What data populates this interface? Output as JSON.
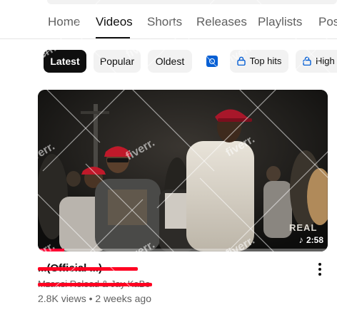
{
  "tabs": [
    {
      "label": "Home"
    },
    {
      "label": "Videos"
    },
    {
      "label": "Shorts"
    },
    {
      "label": "Releases"
    },
    {
      "label": "Playlists"
    },
    {
      "label": "Pos"
    }
  ],
  "active_tab": "Videos",
  "filters": {
    "chips": [
      {
        "label": "Latest"
      },
      {
        "label": "Popular"
      },
      {
        "label": "Oldest"
      }
    ],
    "selected": "Latest",
    "members_only": [
      {
        "label": "Top hits"
      },
      {
        "label": "High"
      }
    ]
  },
  "video": {
    "duration": "2:58",
    "progress": 0.09,
    "thumbnail_overlay_text": "REAL",
    "title": "...(Official ...)",
    "channel": "Mzansi Reload & Jay KaBo",
    "views": "2.8K views",
    "age": "2 weeks ago",
    "separator": "•"
  },
  "colors": {
    "accent": "#0f0f0f",
    "progress": "#ff0033",
    "redaction": "#ff0022",
    "secondary_text": "#606060",
    "chip_bg": "#f2f2f2",
    "ai_icon": "#065fd4"
  },
  "icons": [
    "ai-sparkle-icon",
    "lock-icon",
    "music-note-icon",
    "more-vert-icon"
  ]
}
